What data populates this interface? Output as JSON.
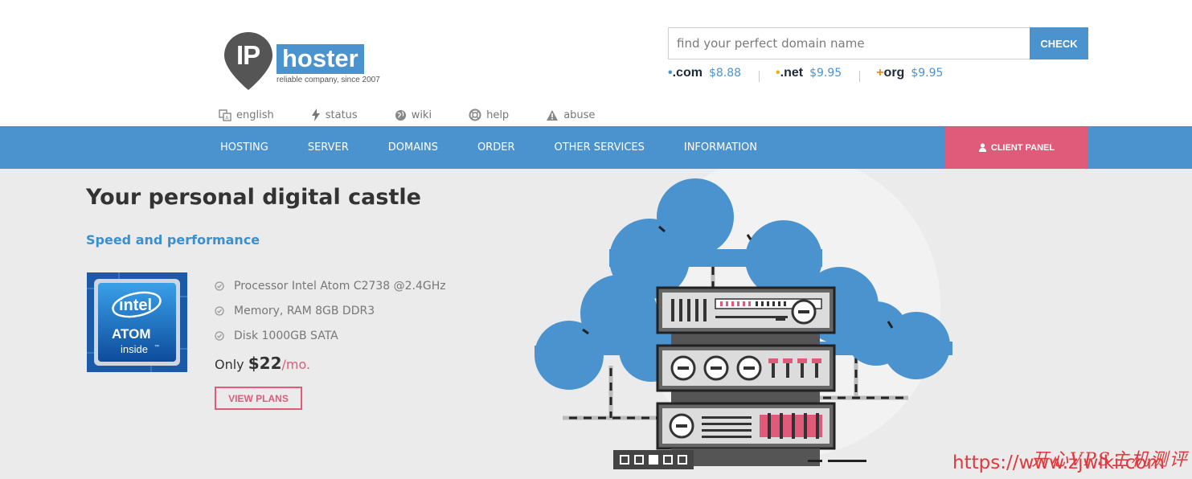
{
  "logo": {
    "ip": "IP",
    "word": "hoster",
    "tagline": "reliable company, since 2007",
    "colors": {
      "pin": "#555555",
      "word_bg": "#4a93cf"
    }
  },
  "search": {
    "placeholder": "find your perfect domain name",
    "button_label": "CHECK"
  },
  "tlds": [
    {
      "name": ".com",
      "price": "$8.88"
    },
    {
      "name": ".net",
      "price": "$9.95"
    },
    {
      "name": "org",
      "price": "$9.95"
    }
  ],
  "util_nav": [
    {
      "label": "english",
      "icon": "language-icon"
    },
    {
      "label": "status",
      "icon": "bolt-icon"
    },
    {
      "label": "wiki",
      "icon": "globe-icon"
    },
    {
      "label": "help",
      "icon": "lifebuoy-icon"
    },
    {
      "label": "abuse",
      "icon": "warning-icon"
    }
  ],
  "main_nav": [
    {
      "label": "HOSTING"
    },
    {
      "label": "SERVER"
    },
    {
      "label": "DOMAINS"
    },
    {
      "label": "ORDER"
    },
    {
      "label": "OTHER SERVICES"
    },
    {
      "label": "INFORMATION"
    }
  ],
  "client_panel": {
    "label": "CLIENT PANEL",
    "icon": "user-icon"
  },
  "hero": {
    "title": "Your personal digital castle",
    "subtitle": "Speed and performance",
    "badge": {
      "brand": "intel",
      "line1": "ATOM",
      "line2": "inside",
      "tm": "™"
    },
    "features": [
      "Processor Intel Atom C2738 @2.4GHz",
      "Memory, RAM 8GB DDR3",
      "Disk 1000GB SATA"
    ],
    "price": {
      "prefix": "Only ",
      "amount": "$22",
      "unit": "/mo."
    },
    "cta_label": "VIEW PLANS"
  },
  "slider": {
    "count": 5,
    "active_index": 2
  },
  "watermark": {
    "url": "https://www.zjwiki.com",
    "cn": "开心VPS主机测评"
  },
  "colors": {
    "accent_blue": "#4a93cf",
    "accent_pink": "#e05a7a",
    "hero_bg": "#ebebeb"
  }
}
